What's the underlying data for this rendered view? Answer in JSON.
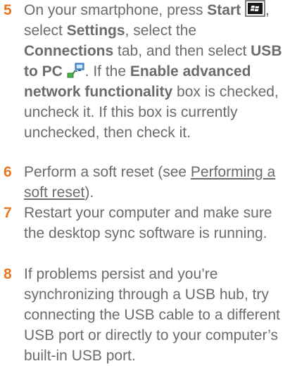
{
  "steps": [
    {
      "number": "5",
      "t1": "On your smartphone, press ",
      "start_label": "Start",
      "t2": ", select ",
      "settings_label": "Settings",
      "t3": ", select the ",
      "connections_label": "Connections",
      "t4": " tab, and then select ",
      "usb_to_pc_label": "USB to PC",
      "t5": ". If the ",
      "option_label": "Enable advanced network functionality",
      "t6": " box is checked, uncheck it. If this box is currently unchecked, then check it."
    },
    {
      "number": "6",
      "t1": "Perform a soft reset (see ",
      "link_label": "Performing a soft reset",
      "t2": ")."
    },
    {
      "number": "7",
      "text": "Restart your computer and make sure the desktop sync software is running."
    },
    {
      "number": "8",
      "text": "If problems persist and you’re synchronizing through a USB hub, try connecting the USB cable to a different USB port or directly to your computer’s built-in USB port."
    }
  ],
  "icons": {
    "start": "windows-start-icon",
    "usb_to_pc": "usb-to-pc-icon"
  },
  "colors": {
    "step_number": "#e87722",
    "body_text": "#6b6b6b"
  }
}
